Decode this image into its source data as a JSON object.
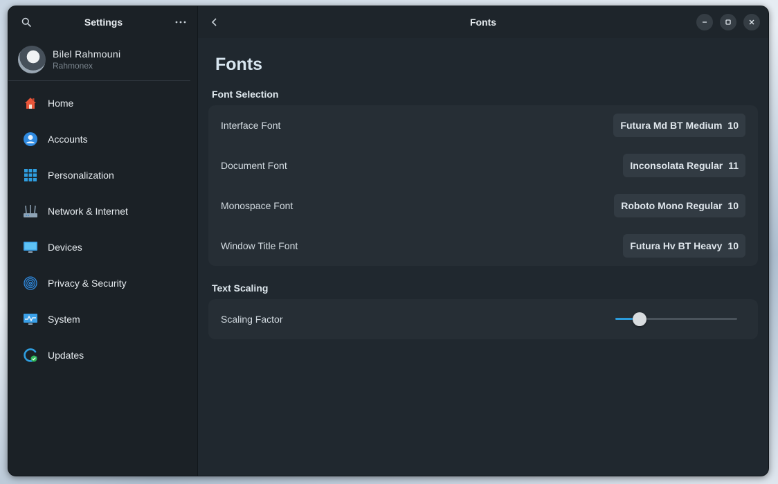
{
  "sidebar": {
    "title": "Settings",
    "profile": {
      "name": "Bilel Rahmouni",
      "username": "Rahmonex"
    },
    "items": [
      {
        "label": "Home",
        "icon": "home-icon",
        "color": "#e8563a"
      },
      {
        "label": "Accounts",
        "icon": "account-icon",
        "color": "#2f8ae0"
      },
      {
        "label": "Personalization",
        "icon": "grid-icon",
        "color": "#2f9ee0"
      },
      {
        "label": "Network & Internet",
        "icon": "network-icon",
        "color": "#8fa4b6"
      },
      {
        "label": "Devices",
        "icon": "monitor-icon",
        "color": "#3aa0e8"
      },
      {
        "label": "Privacy & Security",
        "icon": "fingerprint-icon",
        "color": "#2f8ae0"
      },
      {
        "label": "System",
        "icon": "system-monitor-icon",
        "color": "#3aa0e8"
      },
      {
        "label": "Updates",
        "icon": "update-icon",
        "color": "#2f9ee0"
      }
    ]
  },
  "header": {
    "title": "Fonts"
  },
  "page": {
    "title": "Fonts",
    "font_selection": {
      "title": "Font Selection",
      "rows": [
        {
          "label": "Interface Font",
          "font": "Futura Md BT Medium",
          "size": "10"
        },
        {
          "label": "Document Font",
          "font": "Inconsolata Regular",
          "size": "11"
        },
        {
          "label": "Monospace Font",
          "font": "Roboto Mono Regular",
          "size": "10"
        },
        {
          "label": "Window Title Font",
          "font": "Futura Hv BT Heavy",
          "size": "10"
        }
      ]
    },
    "text_scaling": {
      "title": "Text Scaling",
      "row_label": "Scaling Factor",
      "slider_value": 0.2
    }
  },
  "colors": {
    "accent": "#2b9bdb",
    "window_bg": "#20282f",
    "sidebar_bg": "#1b2126",
    "card_bg": "#262e35"
  }
}
